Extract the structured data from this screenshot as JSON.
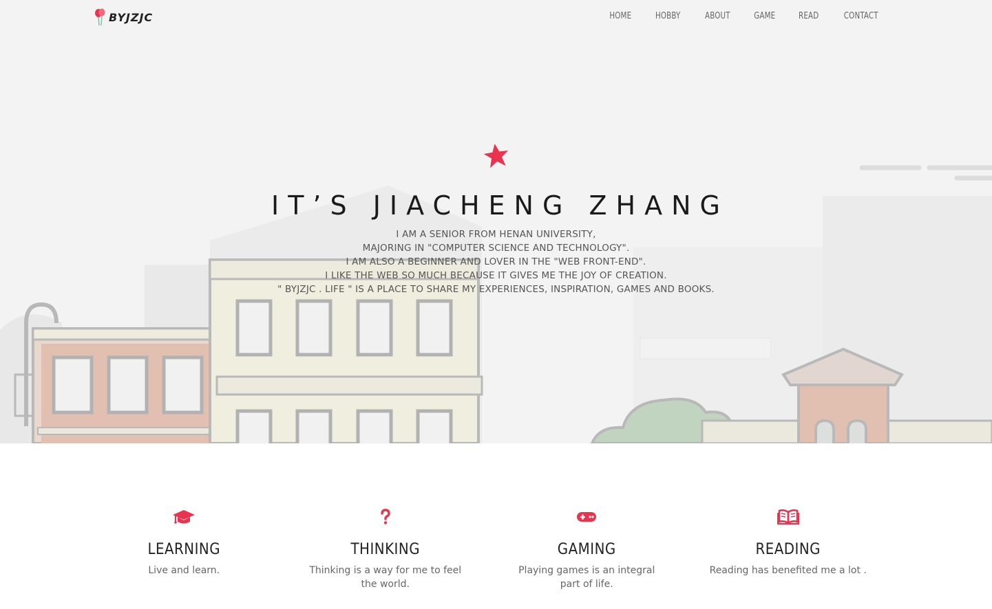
{
  "brand": {
    "logo_text": "BYJZJC",
    "accent_color": "#e8344e"
  },
  "nav": {
    "items": [
      {
        "label": "HOME"
      },
      {
        "label": "HOBBY"
      },
      {
        "label": "ABOUT"
      },
      {
        "label": "GAME"
      },
      {
        "label": "READ"
      },
      {
        "label": "CONTACT"
      }
    ]
  },
  "hero": {
    "icon": "star-icon",
    "title": "IT’S JIACHENG ZHANG",
    "lines": [
      "I AM A SENIOR FROM HENAN UNIVERSITY,",
      "MAJORING IN \"COMPUTER SCIENCE AND TECHNOLOGY\".",
      "I AM ALSO A BEGINNER AND LOVER IN THE \"WEB FRONT-END\".",
      "I LIKE THE WEB SO MUCH BECAUSE IT GIVES ME THE JOY OF CREATION.",
      "\" BYJZJC . LIFE \" IS A PLACE TO SHARE MY EXPERIENCES, INSPIRATION, GAMES AND BOOKS."
    ]
  },
  "features": [
    {
      "icon": "graduation-cap-icon",
      "title": "LEARNING",
      "description": "Live and learn."
    },
    {
      "icon": "question-mark-icon",
      "title": "THINKING",
      "description": "Thinking is a way for me to feel the world."
    },
    {
      "icon": "gamepad-icon",
      "title": "GAMING",
      "description": "Playing games is an integral part of life."
    },
    {
      "icon": "open-book-icon",
      "title": "READING",
      "description": "Reading has benefited me a lot ."
    }
  ]
}
